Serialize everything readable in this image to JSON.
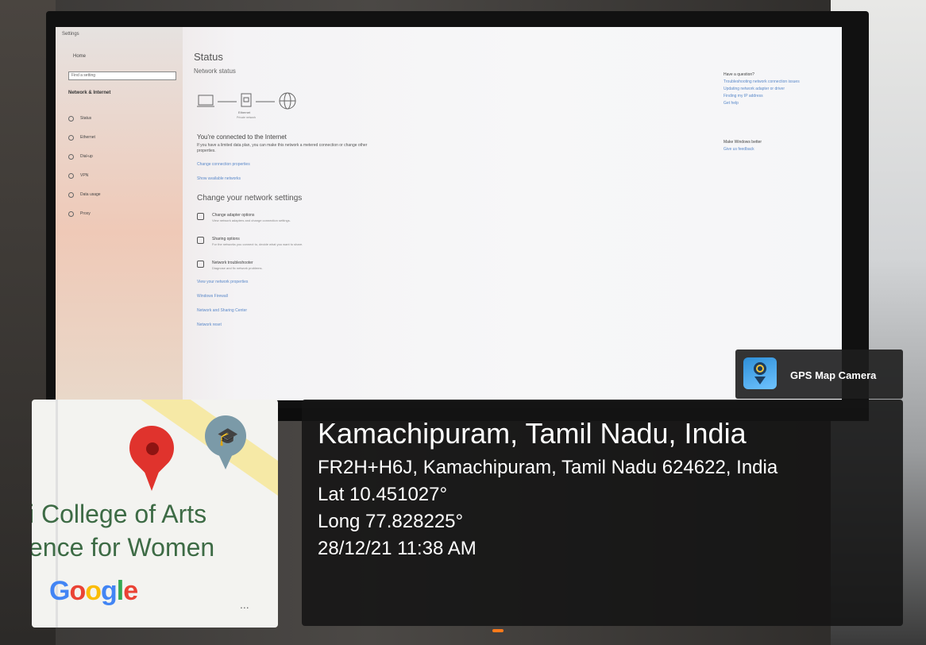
{
  "settings_window": {
    "app_title": "Settings",
    "sidebar": {
      "home": "Home",
      "search_placeholder": "Find a setting",
      "category": "Network & Internet",
      "items": [
        "Status",
        "Ethernet",
        "Dial-up",
        "VPN",
        "Data usage",
        "Proxy"
      ]
    },
    "main": {
      "heading": "Status",
      "subheading": "Network status",
      "network_label": "Ethernet",
      "network_type": "Private network",
      "connected_title": "You're connected to the Internet",
      "connected_body": "If you have a limited data plan, you can make this network a metered connection or change other properties.",
      "link_change_props": "Change connection properties",
      "link_show_networks": "Show available networks",
      "change_heading": "Change your network settings",
      "options": [
        {
          "title": "Change adapter options",
          "desc": "View network adapters and change connection settings."
        },
        {
          "title": "Sharing options",
          "desc": "For the networks you connect to, decide what you want to share."
        },
        {
          "title": "Network troubleshooter",
          "desc": "Diagnose and fix network problems."
        }
      ],
      "bottom_links": [
        "View your network properties",
        "Windows Firewall",
        "Network and Sharing Center",
        "Network reset"
      ]
    },
    "right_panel": {
      "q_heading": "Have a question?",
      "q_links": [
        "Troubleshooting network connection issues",
        "Updating network adapter or driver",
        "Finding my IP address",
        "Get help"
      ],
      "improve_heading": "Make Windows better",
      "feedback": "Give us feedback"
    }
  },
  "gps_overlay": {
    "app_name": "GPS Map Camera",
    "place": "Kamachipuram, Tamil Nadu, India",
    "address": "FR2H+H6J, Kamachipuram, Tamil Nadu 624622, India",
    "lat": "Lat 10.451027°",
    "long": "Long 77.828225°",
    "datetime": "28/12/21 11:38 AM"
  },
  "map": {
    "label_line1": "i College of Arts",
    "label_line2": "ence for Women",
    "provider": "Google",
    "more": "..."
  }
}
